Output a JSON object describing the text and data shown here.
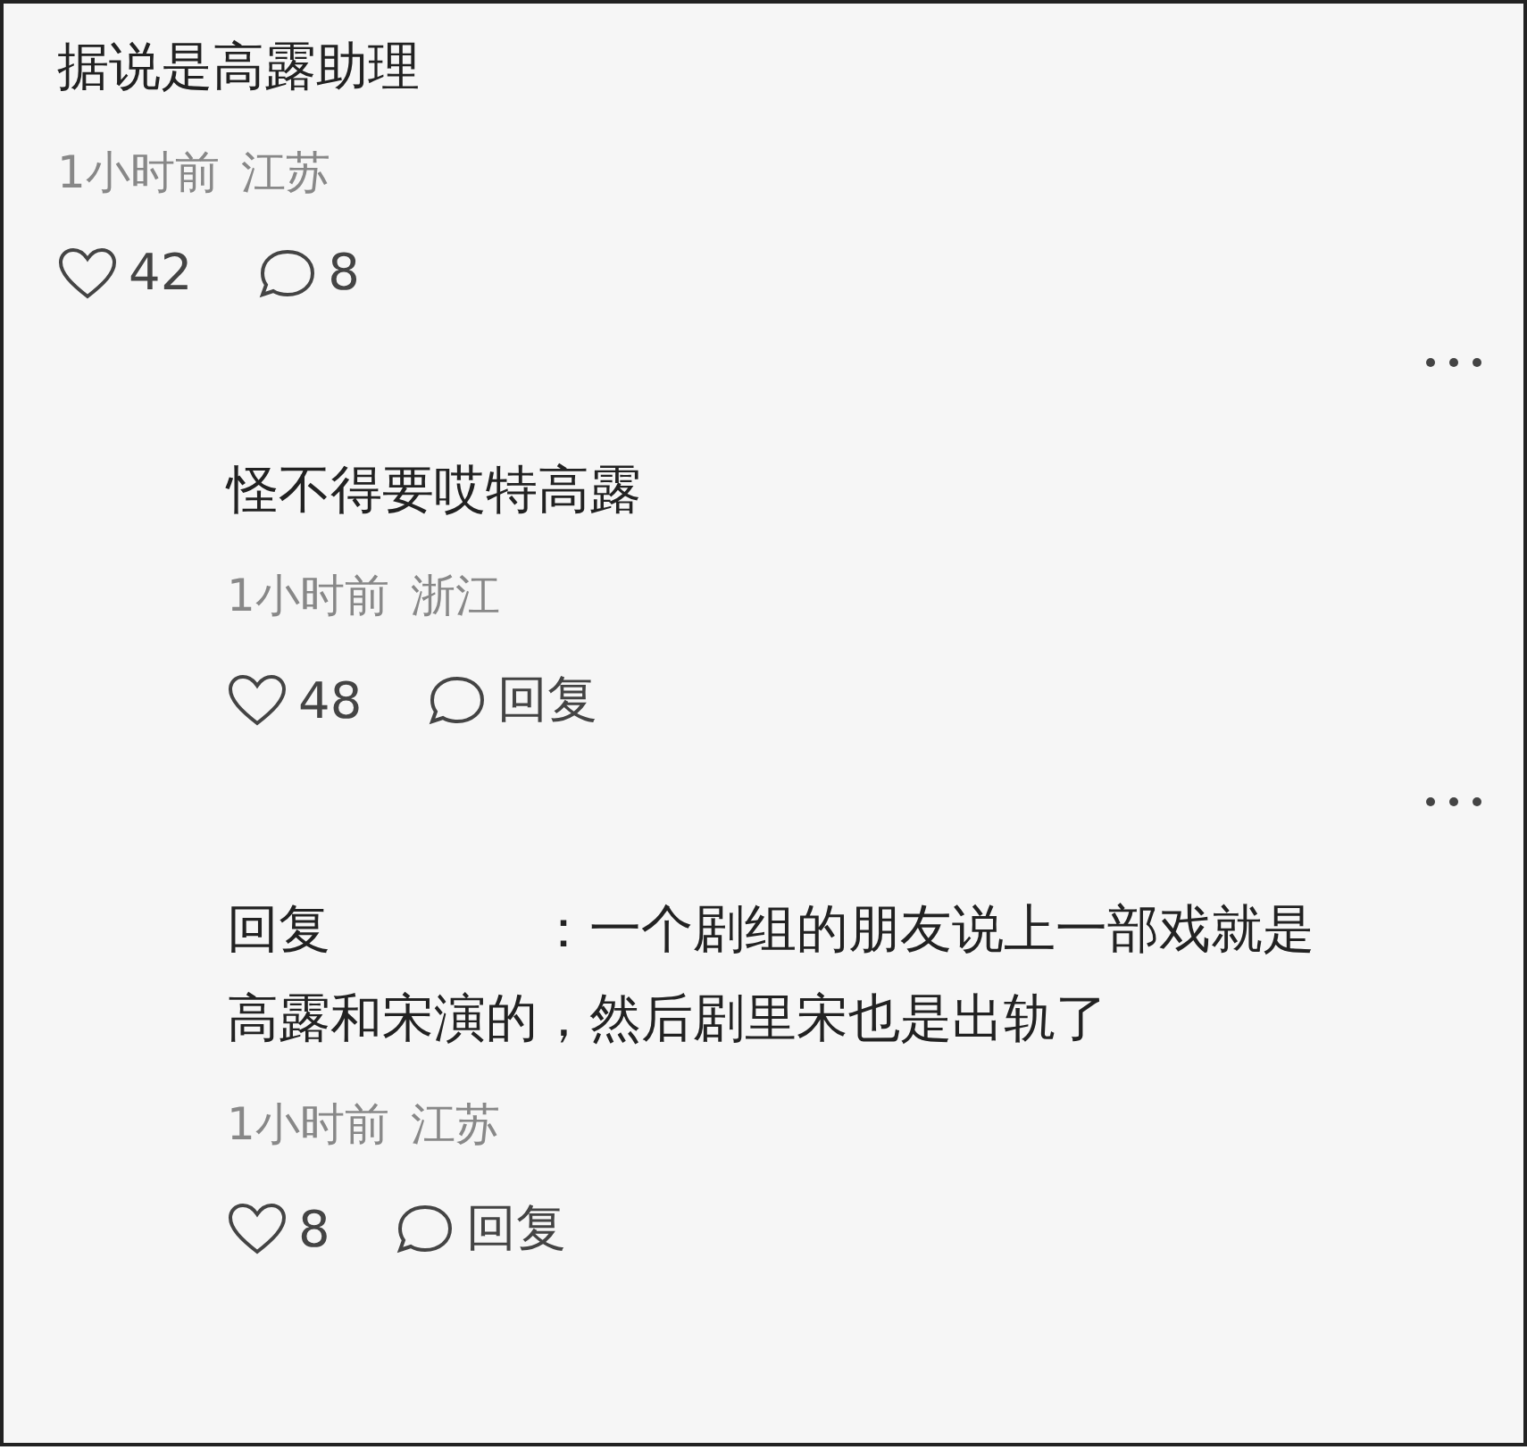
{
  "comments": [
    {
      "kind": "top",
      "text": "据说是高露助理",
      "time": "1小时前",
      "location": "江苏",
      "likes": "42",
      "reply": "8",
      "more_menu": false
    },
    {
      "kind": "reply",
      "text": "怪不得要哎特高露",
      "time": "1小时前",
      "location": "浙江",
      "likes": "48",
      "reply": "回复",
      "more_menu": true
    },
    {
      "kind": "reply",
      "text": "回复　　　　：一个剧组的朋友说上一部戏就是高露和宋演的，然后剧里宋也是出轨了",
      "time": "1小时前",
      "location": "江苏",
      "likes": "8",
      "reply": "回复",
      "more_menu": true
    }
  ]
}
